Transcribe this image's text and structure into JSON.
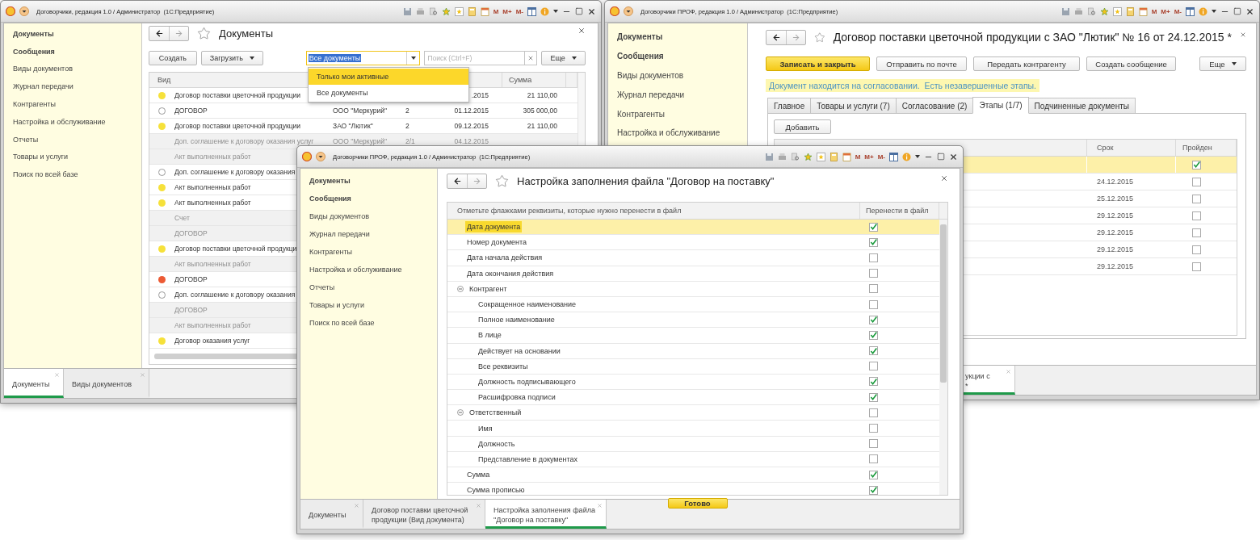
{
  "windows": [
    {
      "kind": "list",
      "title_bar": {
        "title": "Договорчики, редакция 1.0 / Администратор  (1С:Предприятие)",
        "memory_buttons": [
          "M",
          "M+",
          "M-"
        ]
      },
      "sidebar": [
        {
          "label": "Документы",
          "kind": "section"
        },
        {
          "label": "Сообщения",
          "kind": "section"
        },
        {
          "label": "Виды документов",
          "kind": "link"
        },
        {
          "label": "Журнал передачи",
          "kind": "link"
        },
        {
          "label": "Контрагенты",
          "kind": "link"
        },
        {
          "label": "Настройка и обслуживание",
          "kind": "link"
        },
        {
          "label": "Отчеты",
          "kind": "link"
        },
        {
          "label": "Товары и услуги",
          "kind": "link"
        },
        {
          "label": "Поиск по всей базе",
          "kind": "link"
        }
      ],
      "page": {
        "title": "Документы",
        "buttons": [
          {
            "label": "Создать",
            "menu": false
          },
          {
            "label": "Загрузить",
            "menu": true
          }
        ],
        "filter": {
          "value": "Все документы"
        },
        "search": {
          "placeholder": "Поиск (Ctrl+F)"
        },
        "more_button": "Еще",
        "dropdown": [
          {
            "label": "Только мои активные",
            "selected": true
          },
          {
            "label": "Все документы",
            "selected": false
          }
        ],
        "table": {
          "header": {
            "type": "Вид",
            "amount": "Сумма"
          },
          "rows": [
            {
              "kind": "main",
              "filled": true,
              "color": "#f6e13a",
              "type": "Договор поставки цветочной продукции",
              "date": ".2015",
              "amount": "21 110,00"
            },
            {
              "kind": "main",
              "filled": false,
              "type": "ДОГОВОР",
              "counterparty": "ООО \"Меркурий\"",
              "number": "2",
              "date": "01.12.2015",
              "amount": "305 000,00"
            },
            {
              "kind": "main",
              "filled": true,
              "color": "#f6e13a",
              "type": "Договор поставки цветочной продукции",
              "counterparty": "ЗАО \"Лютик\"",
              "number": "2",
              "date": "09.12.2015",
              "amount": "21 110,00"
            },
            {
              "kind": "sub",
              "type": "Доп. соглашение к договору оказания услуг",
              "counterparty": "ООО \"Меркурий\"",
              "number": "2/1",
              "date": "04.12.2015"
            },
            {
              "kind": "sub",
              "type": "Акт выполненных работ"
            },
            {
              "kind": "main",
              "filled": false,
              "type": "Доп. соглашение к договору оказания"
            },
            {
              "kind": "main",
              "filled": true,
              "color": "#f6e13a",
              "type": "Акт выполненных работ"
            },
            {
              "kind": "main",
              "filled": true,
              "color": "#f6e13a",
              "type": "Акт выполненных работ"
            },
            {
              "kind": "sub",
              "type": "Счет"
            },
            {
              "kind": "sub",
              "type": "ДОГОВОР"
            },
            {
              "kind": "main",
              "filled": true,
              "color": "#f6e13a",
              "type": "Договор поставки цветочной продукци"
            },
            {
              "kind": "sub",
              "type": "Акт выполненных работ"
            },
            {
              "kind": "main",
              "filled": true,
              "color": "#ec5a34",
              "type": "ДОГОВОР"
            },
            {
              "kind": "main",
              "filled": false,
              "type": "Доп. соглашение к договору оказания"
            },
            {
              "kind": "sub",
              "type": "ДОГОВОР"
            },
            {
              "kind": "sub",
              "type": "Акт выполненных работ"
            },
            {
              "kind": "main",
              "filled": true,
              "color": "#f6e13a",
              "type": "Договор оказания услуг"
            }
          ]
        }
      },
      "tabs": [
        {
          "lines": [
            "Документы"
          ],
          "selected": true
        },
        {
          "lines": [
            "Виды документов"
          ],
          "selected": false
        }
      ]
    },
    {
      "kind": "document",
      "title_bar": {
        "title": "Договорчики ПРОФ, редакция 1.0 / Администратор  (1С:Предприятие)",
        "memory_buttons": [
          "M",
          "M+",
          "M-"
        ]
      },
      "sidebar": [
        {
          "label": "Документы",
          "kind": "section"
        },
        {
          "label": "Сообщения",
          "kind": "section"
        },
        {
          "label": "Виды документов",
          "kind": "link"
        },
        {
          "label": "Журнал передачи",
          "kind": "link"
        },
        {
          "label": "Контрагенты",
          "kind": "link"
        },
        {
          "label": "Настройка и обслуживание",
          "kind": "link"
        }
      ],
      "page": {
        "title": "Договор поставки цветочной продукции с ЗАО \"Лютик\" № 16 от 24.12.2015 *",
        "buttons": [
          {
            "label": "Записать и закрыть",
            "primary": true
          },
          {
            "label": "Отправить по почте",
            "primary": false
          },
          {
            "label": "Передать контрагенту",
            "primary": false
          },
          {
            "label": "Создать сообщение",
            "primary": false
          }
        ],
        "more_button": "Еще",
        "notice": "Документ находится на согласовании.  Есть незавершенные этапы.",
        "tabs": [
          {
            "label": "Главное",
            "selected": false
          },
          {
            "label": "Товары и услуги (7)",
            "selected": false
          },
          {
            "label": "Согласование (2)",
            "selected": false
          },
          {
            "label": "Этапы (1/7)",
            "selected": true
          },
          {
            "label": "Подчиненные документы",
            "selected": false
          }
        ],
        "add_button": "Добавить",
        "table": {
          "header": {
            "deadline": "Срок",
            "passed": "Пройден"
          },
          "rows": [
            {
              "selected": true,
              "passed": true
            },
            {
              "deadline": "24.12.2015",
              "selected": false,
              "passed": false
            },
            {
              "deadline": "25.12.2015",
              "selected": false,
              "passed": false
            },
            {
              "deadline": "29.12.2015",
              "selected": false,
              "passed": false
            },
            {
              "deadline": "29.12.2015",
              "selected": false,
              "passed": false
            },
            {
              "deadline": "29.12.2015",
              "selected": false,
              "passed": false
            },
            {
              "deadline": "29.12.2015",
              "selected": false,
              "passed": false
            }
          ]
        }
      },
      "tabs": [
        {
          "lines": [
            "укции с",
            "*"
          ],
          "selected": true
        }
      ]
    },
    {
      "kind": "settings",
      "title_bar": {
        "title": "Договорчики ПРОФ, редакция 1.0 / Администратор  (1С:Предприятие)",
        "memory_buttons": [
          "M",
          "M+",
          "M-"
        ]
      },
      "sidebar": [
        {
          "label": "Документы",
          "kind": "section"
        },
        {
          "label": "Сообщения",
          "kind": "section"
        },
        {
          "label": "Виды документов",
          "kind": "link"
        },
        {
          "label": "Журнал передачи",
          "kind": "link"
        },
        {
          "label": "Контрагенты",
          "kind": "link"
        },
        {
          "label": "Настройка и обслуживание",
          "kind": "link"
        },
        {
          "label": "Отчеты",
          "kind": "link"
        },
        {
          "label": "Товары и услуги",
          "kind": "link"
        },
        {
          "label": "Поиск по всей базе",
          "kind": "link"
        }
      ],
      "page": {
        "title": "Настройка заполнения файла \"Договор на поставку\"",
        "header": {
          "label": "Отметьте флажками реквизиты, которые нужно перенести в файл",
          "transfer": "Перенести в файл"
        },
        "tree": [
          {
            "label": "Дата документа",
            "checked": true,
            "selected": true
          },
          {
            "label": "Номер документа",
            "checked": true,
            "selected": false
          },
          {
            "label": "Дата начала действия",
            "checked": false,
            "selected": false
          },
          {
            "label": "Дата окончания действия",
            "checked": false,
            "selected": false
          },
          {
            "label": "Контрагент",
            "checked": false,
            "selected": false,
            "expanded": true,
            "children": [
              {
                "label": "Сокращенное наименование",
                "checked": false,
                "selected": false
              },
              {
                "label": "Полное наименование",
                "checked": true,
                "selected": false
              },
              {
                "label": "В лице",
                "checked": true,
                "selected": false
              },
              {
                "label": "Действует на основании",
                "checked": true,
                "selected": false
              },
              {
                "label": "Все реквизиты",
                "checked": false,
                "selected": false
              },
              {
                "label": "Должность подписывающего",
                "checked": true,
                "selected": false
              },
              {
                "label": "Расшифровка подписи",
                "checked": true,
                "selected": false
              }
            ]
          },
          {
            "label": "Ответственный",
            "checked": false,
            "selected": false,
            "expanded": true,
            "children": [
              {
                "label": "Имя",
                "checked": false,
                "selected": false
              },
              {
                "label": "Должность",
                "checked": false,
                "selected": false
              },
              {
                "label": "Представление в документах",
                "checked": false,
                "selected": false
              }
            ]
          },
          {
            "label": "Сумма",
            "checked": true,
            "selected": false
          },
          {
            "label": "Сумма прописью",
            "checked": true,
            "selected": false
          }
        ],
        "done_button": "Готово"
      },
      "tabs": [
        {
          "lines": [
            "Документы"
          ],
          "selected": false
        },
        {
          "lines": [
            "Договор поставки цветочной",
            "продукции (Вид документа)"
          ],
          "selected": false
        },
        {
          "lines": [
            "Настройка заполнения файла",
            "\"Договор на поставку\""
          ],
          "selected": true
        }
      ]
    }
  ]
}
